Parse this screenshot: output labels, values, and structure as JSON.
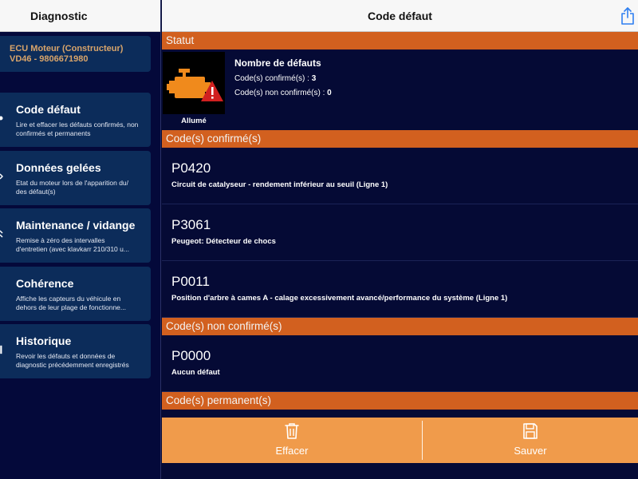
{
  "sidebar": {
    "title": "Diagnostic",
    "ecu": {
      "line1": "ECU Moteur (Constructeur)",
      "line2": "VD46 - 9806671980"
    },
    "items": [
      {
        "title": "Code défaut",
        "desc": "Lire et effacer les défauts confirmés, non confirmés et permanents",
        "icon": "partial-menu-icon"
      },
      {
        "title": "Données gelées",
        "desc1": "Etat du moteur lors de l'apparition du/",
        "desc2": "des défaut(s)",
        "icon": "partial-menu-icon"
      },
      {
        "title": "Maintenance / vidange",
        "desc1": "Remise à zéro des intervalles",
        "desc2": "d'entretien (avec klavkarr 210/310 u...",
        "icon": "partial-menu-icon"
      },
      {
        "title": "Cohérence",
        "desc1": "Affiche les capteurs du véhicule en",
        "desc2": "dehors de leur plage de fonctionne...",
        "icon": "partial-menu-icon"
      },
      {
        "title": "Historique",
        "desc": "Revoir les défauts et données de diagnostic précédemment enregistrés",
        "icon": "partial-menu-icon"
      }
    ]
  },
  "main": {
    "title": "Code défaut",
    "share_icon": "share-icon",
    "statut": {
      "header": "Statut",
      "engine_label": "Allumé",
      "count_title": "Nombre de défauts",
      "confirmed_label": "Code(s) confirmé(s) :",
      "confirmed_count": "3",
      "unconfirmed_label": "Code(s) non confirmé(s) :",
      "unconfirmed_count": "0"
    },
    "confirmed": {
      "header": "Code(s) confirmé(s)",
      "codes": [
        {
          "code": "P0420",
          "desc": "Circuit de catalyseur - rendement inférieur au seuil (Ligne 1)"
        },
        {
          "code": "P3061",
          "desc": "Peugeot: Détecteur de chocs"
        },
        {
          "code": "P0011",
          "desc": "Position d'arbre à cames A - calage excessivement avancé/performance du système (Ligne 1)"
        }
      ]
    },
    "unconfirmed": {
      "header": "Code(s) non confirmé(s)",
      "codes": [
        {
          "code": "P0000",
          "desc": "Aucun défaut"
        }
      ]
    },
    "permanent": {
      "header": "Code(s) permanent(s)"
    }
  },
  "footer": {
    "erase_label": "Effacer",
    "save_label": "Sauver"
  },
  "colors": {
    "section_orange": "#d2601f",
    "footer_orange": "#f09b4b",
    "background_navy": "#050a35",
    "card_blue": "#0c2c5a",
    "ecu_text": "#d8a46a",
    "engine_icon": "#f08a1c",
    "warning_red": "#d12020"
  }
}
